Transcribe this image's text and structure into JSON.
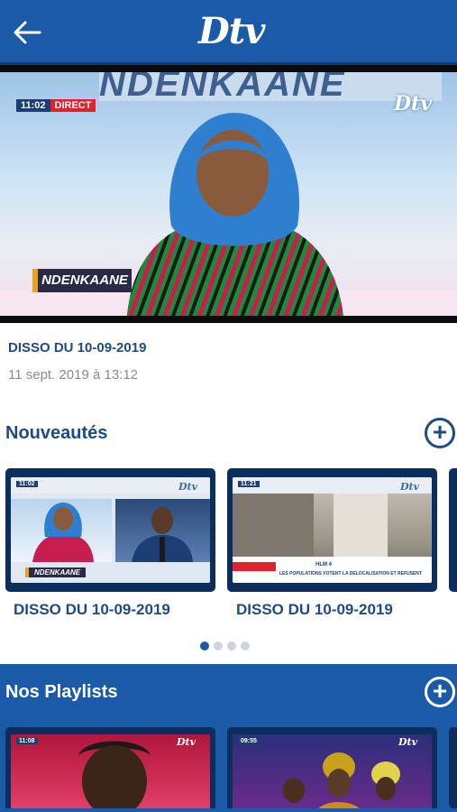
{
  "header": {
    "back_label": "",
    "logo_text": "Dtv"
  },
  "player": {
    "live_time": "11:02",
    "live_label": "DIRECT",
    "banner_text": "NDENKAANE",
    "corner_logo": "Dtv",
    "show_logo": "NDENKAANE"
  },
  "video": {
    "title": "DISSO DU 10-09-2019",
    "date": "11 sept. 2019 à 13:12"
  },
  "nouveautes": {
    "title": "Nouveautés",
    "plus": "+",
    "items": [
      {
        "title": "DISSO DU 10-09-2019",
        "thumb_tag": "11:02",
        "thumb_logo": "Dtv",
        "thumb_show": "NDENKAANE"
      },
      {
        "title": "DISSO DU 10-09-2019",
        "thumb_tag": "11:21",
        "thumb_logo": "Dtv",
        "thumb_headline": "HLM 4",
        "thumb_ticker": "LES POPULATIONS VOTENT LA DELOCALISATION ET REFUSENT"
      }
    ],
    "pagination": {
      "count": 4,
      "active": 1
    }
  },
  "playlists": {
    "title": "Nos Playlists",
    "plus": "+",
    "items": [
      {
        "thumb_tag": "11:08",
        "thumb_logo": "Dtv"
      },
      {
        "thumb_tag": "09:55",
        "thumb_logo": "Dtv"
      }
    ]
  },
  "colors": {
    "brand_blue": "#1b5aa6",
    "dark_blue": "#0c2e5e",
    "text_blue": "#1e4a86",
    "live_red": "#e0222a"
  }
}
